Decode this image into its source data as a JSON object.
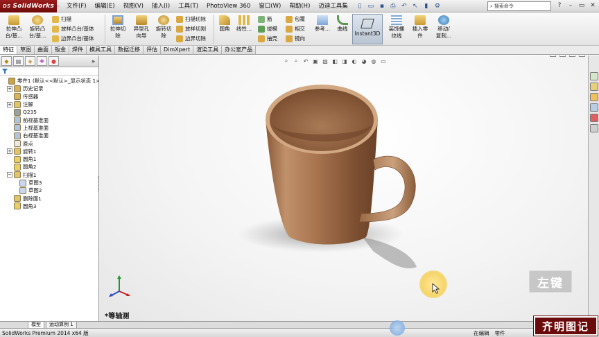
{
  "app": {
    "logo_text": "SolidWorks",
    "logo_prefix": "DS"
  },
  "menu": [
    "文件(F)",
    "编辑(E)",
    "视图(V)",
    "插入(I)",
    "工具(T)",
    "PhotoView 360",
    "窗口(W)",
    "帮助(H)",
    "迈迪工具集"
  ],
  "search": {
    "placeholder": "搜索命令"
  },
  "ribbon": {
    "extrude_boss": [
      "拉伸凸",
      "台/基..."
    ],
    "revolve_boss": [
      "旋转凸",
      "台/基..."
    ],
    "sweep": "扫描",
    "loft": "放样凸台/基体",
    "boundary": "边界凸台/基体",
    "extrude_cut": [
      "拉伸切",
      "除"
    ],
    "hole_wizard": [
      "异型孔",
      "向导"
    ],
    "revolve_cut": [
      "旋转切",
      "除"
    ],
    "sweep_cut": "扫描切除",
    "loft_cut": "放样切割",
    "boundary_cut": "边界切除",
    "fillet": [
      "圆角",
      ""
    ],
    "linear_pattern": [
      "线性...",
      ""
    ],
    "rib": "筋",
    "draft": "拔模",
    "shell": "抽壳",
    "wrap": "包覆",
    "intersect": "相交",
    "mirror": "镜向",
    "reference": [
      "参考...",
      ""
    ],
    "curves": [
      "曲线",
      ""
    ],
    "instant3d": "Instant3D",
    "cosmetic_thread": [
      "装饰螺",
      "纹线"
    ],
    "insert_part": [
      "插入零",
      "件"
    ],
    "move_copy": [
      "移动/",
      "复制..."
    ]
  },
  "tabs": [
    "特征",
    "草图",
    "曲面",
    "钣金",
    "焊件",
    "模具工具",
    "数据迁移",
    "评估",
    "DimXpert",
    "渲染工具",
    "办公室产品"
  ],
  "tree": [
    {
      "label": "零件1  (默认<<默认>_显示状态 1>)",
      "icon": "part-icon",
      "color": "#c9a24a",
      "indent": 0,
      "expander": ""
    },
    {
      "label": "历史记录",
      "icon": "history-icon",
      "color": "#d9b25e",
      "indent": 1,
      "expander": "+"
    },
    {
      "label": "传感器",
      "icon": "sensors-icon",
      "color": "#d9b25e",
      "indent": 1,
      "expander": ""
    },
    {
      "label": "注解",
      "icon": "annotations-icon",
      "color": "#e0c46a",
      "indent": 1,
      "expander": "+"
    },
    {
      "label": "Q235",
      "icon": "material-icon",
      "color": "#9aa0a8",
      "indent": 1,
      "expander": ""
    },
    {
      "label": "前视基准面",
      "icon": "plane-icon",
      "color": "#b0c4de",
      "indent": 1,
      "expander": ""
    },
    {
      "label": "上视基准面",
      "icon": "plane-icon",
      "color": "#b0c4de",
      "indent": 1,
      "expander": ""
    },
    {
      "label": "右视基准面",
      "icon": "plane-icon",
      "color": "#b0c4de",
      "indent": 1,
      "expander": ""
    },
    {
      "label": "原点",
      "icon": "origin-icon",
      "color": "#e8e8e8",
      "indent": 1,
      "expander": ""
    },
    {
      "label": "旋转1",
      "icon": "revolve-feature-icon",
      "color": "#e0c46a",
      "indent": 1,
      "expander": "+"
    },
    {
      "label": "圆角1",
      "icon": "fillet-feature-icon",
      "color": "#e8d066",
      "indent": 1,
      "expander": ""
    },
    {
      "label": "圆角2",
      "icon": "fillet-feature-icon",
      "color": "#e8d066",
      "indent": 1,
      "expander": ""
    },
    {
      "label": "扫描1",
      "icon": "sweep-feature-icon",
      "color": "#e0c46a",
      "indent": 1,
      "expander": "−"
    },
    {
      "label": "草图3",
      "icon": "sketch-icon",
      "color": "#c9d7ec",
      "indent": 2,
      "expander": ""
    },
    {
      "label": "草图2",
      "icon": "sketch-icon",
      "color": "#c9d7ec",
      "indent": 2,
      "expander": ""
    },
    {
      "label": "删除面1",
      "icon": "delete-face-icon",
      "color": "#e0c46a",
      "indent": 1,
      "expander": ""
    },
    {
      "label": "圆角3",
      "icon": "fillet-feature-icon",
      "color": "#e8d066",
      "indent": 1,
      "expander": ""
    }
  ],
  "viewport": {
    "orientation_label": "*等轴测",
    "mouse_caption": "左键"
  },
  "bottom_tabs": [
    "模型",
    "运动算例 1"
  ],
  "status": {
    "left": "SolidWorks Premium 2014 x64 版",
    "editing": "在编辑",
    "doc_type": "零件"
  },
  "watermark": "齐明图记",
  "colors": {
    "accent": "#6e0b0b",
    "mug": "#a8744f"
  }
}
